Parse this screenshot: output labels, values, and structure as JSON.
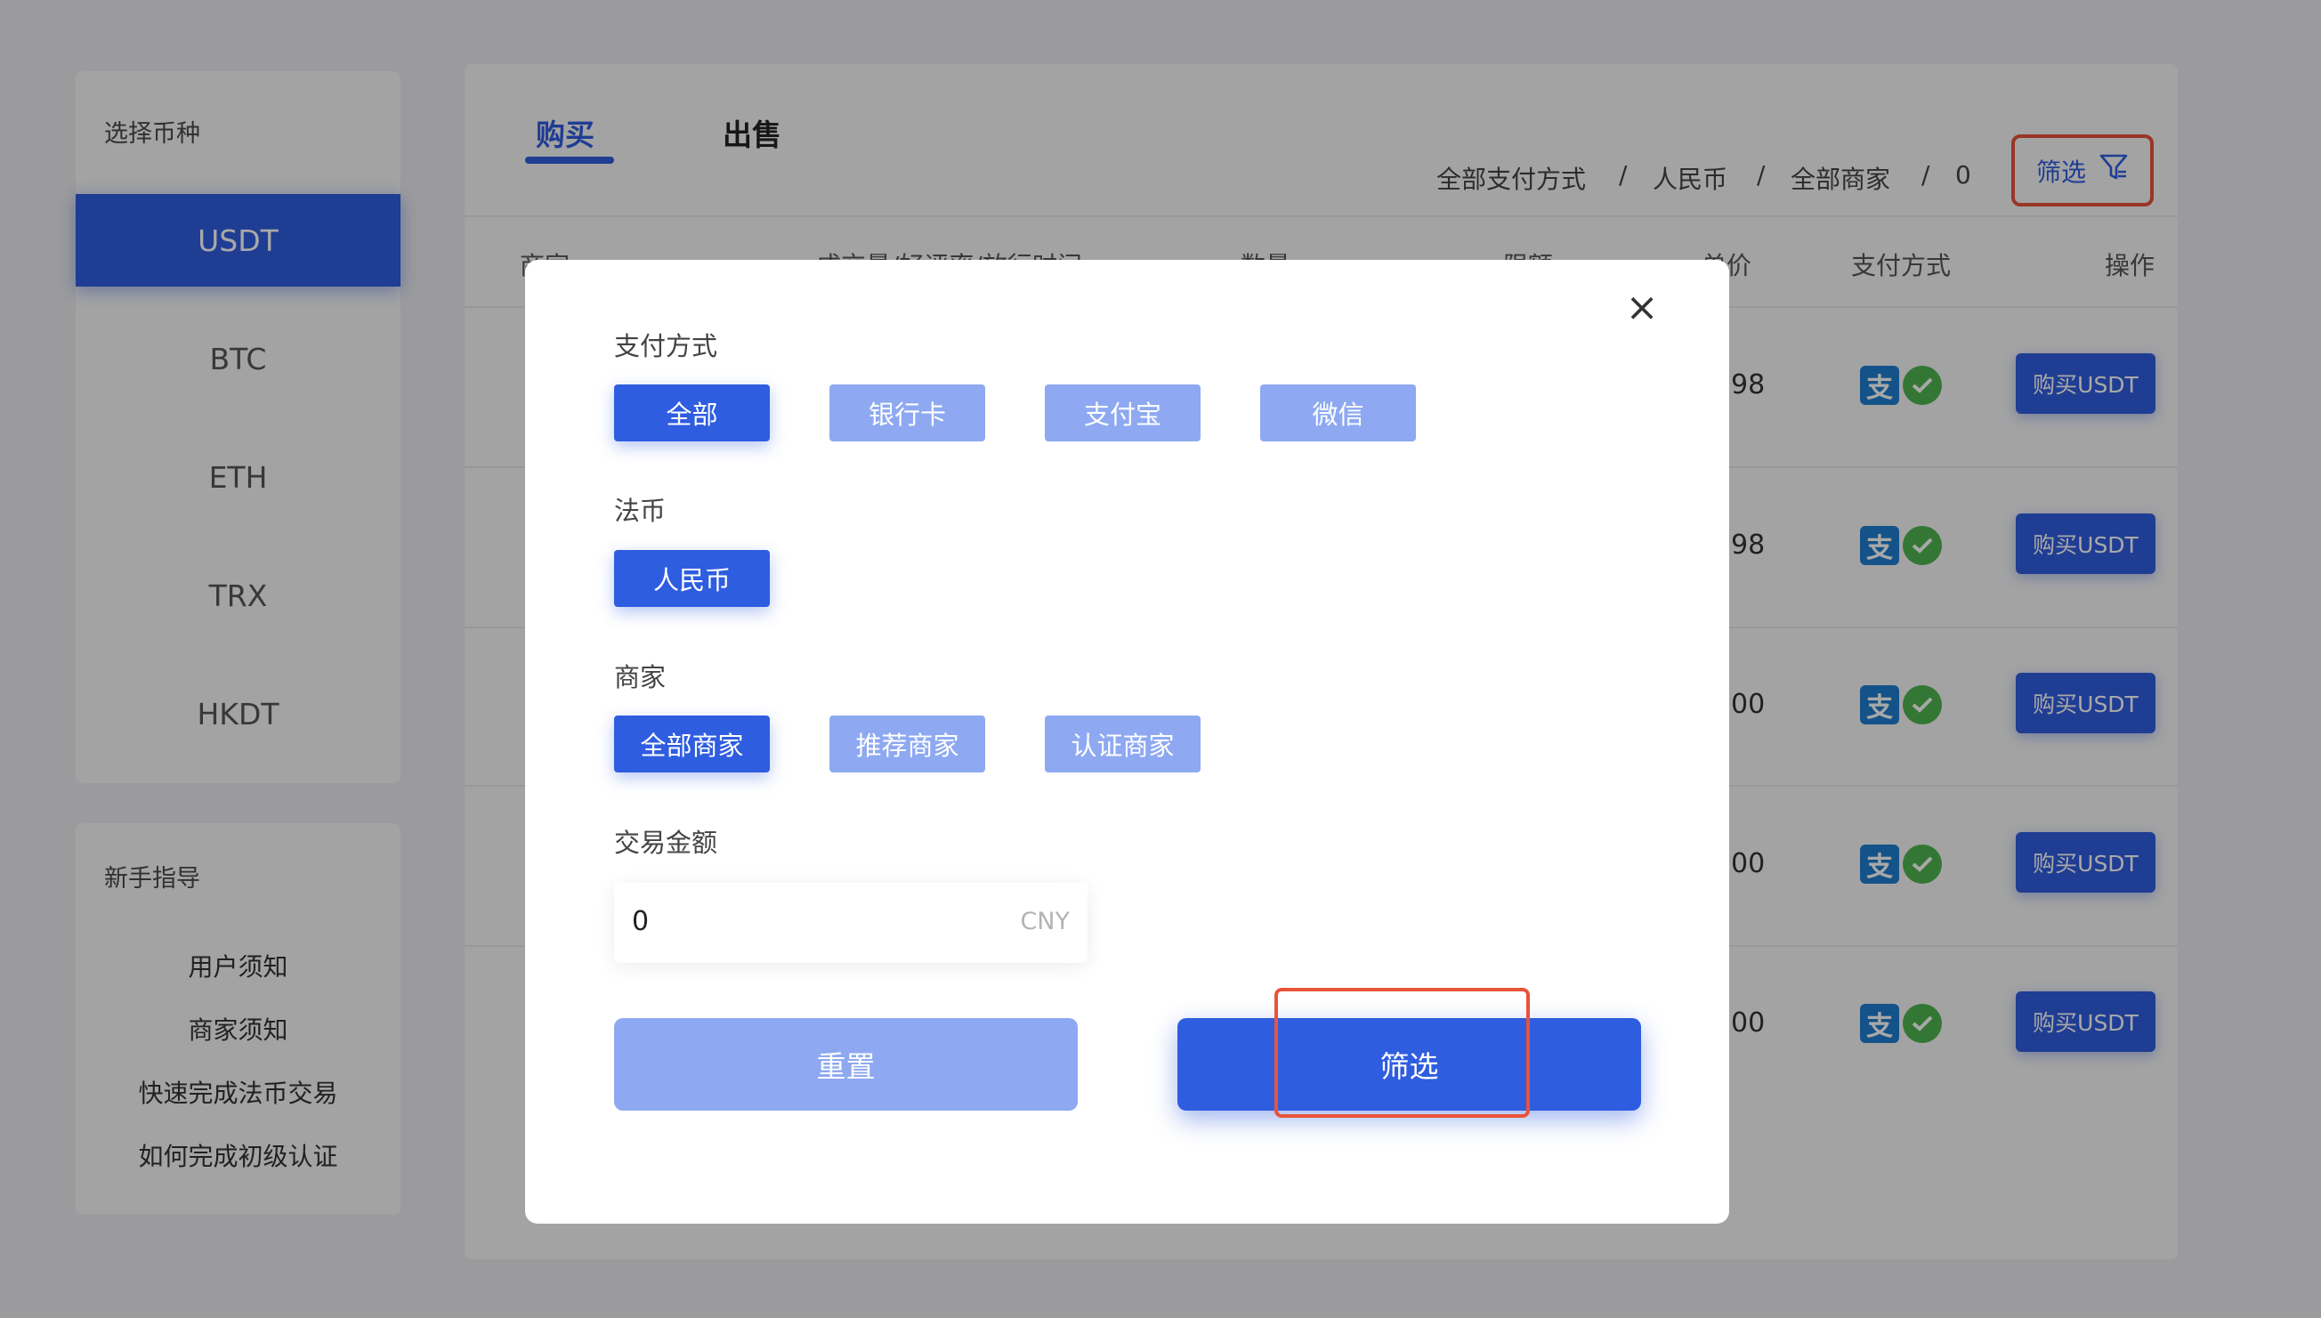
{
  "sidebar": {
    "coin_title": "选择币种",
    "coins": [
      "USDT",
      "BTC",
      "ETH",
      "TRX",
      "HKDT"
    ],
    "active_coin": "USDT",
    "guide_title": "新手指导",
    "guide_links": [
      "用户须知",
      "商家须知",
      "快速完成法币交易",
      "如何完成初级认证"
    ]
  },
  "main": {
    "tabs": [
      "购买",
      "出售"
    ],
    "active_tab": "购买",
    "crumbs": [
      "全部支付方式",
      "/",
      "人民币",
      "/",
      "全部商家",
      "/",
      "0"
    ],
    "filter_label": "筛选",
    "columns": [
      "商家",
      "成交量/好评率/放行时间",
      "数量",
      "限额",
      "单价",
      "支付方式",
      "操作"
    ],
    "rows": [
      {
        "price_tail": "98",
        "action": "购买USDT"
      },
      {
        "price_tail": "98",
        "action": "购买USDT"
      },
      {
        "price_tail": "00",
        "action": "购买USDT"
      },
      {
        "price_tail": "00",
        "action": "购买USDT"
      },
      {
        "price_tail": "00",
        "action": "购买USDT"
      }
    ],
    "pay_icons": [
      "alipay-icon",
      "wechat-icon"
    ],
    "alipay_glyph": "支"
  },
  "modal": {
    "close_glyph": "×",
    "payment_label": "支付方式",
    "payment_options": [
      "全部",
      "银行卡",
      "支付宝",
      "微信"
    ],
    "payment_selected": "全部",
    "fiat_label": "法币",
    "fiat_options": [
      "人民币"
    ],
    "fiat_selected": "人民币",
    "merchant_label": "商家",
    "merchant_options": [
      "全部商家",
      "推荐商家",
      "认证商家"
    ],
    "merchant_selected": "全部商家",
    "amount_label": "交易金额",
    "amount_value": "0",
    "amount_unit": "CNY",
    "reset_label": "重置",
    "submit_label": "筛选"
  },
  "colors": {
    "primary": "#2f5de0",
    "primary_light": "#8ea9f1",
    "highlight": "#e9533a"
  }
}
